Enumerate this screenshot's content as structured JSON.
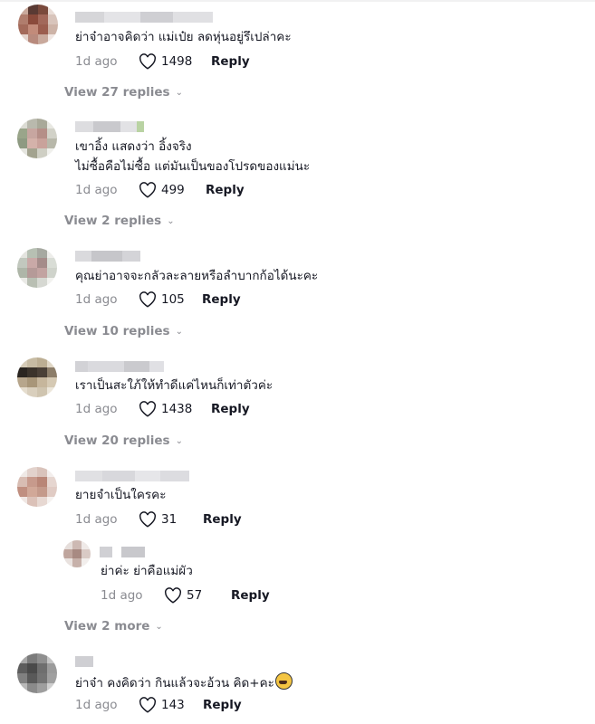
{
  "comments": [
    {
      "text_lines": [
        "ย่าจ๋าอาจคิดว่า แม่เป๋ย ลดหุ่นอยู่รึเปล่าคะ"
      ],
      "time": "1d ago",
      "likes": "1498",
      "reply_label": "Reply",
      "view_replies": "View 27 replies"
    },
    {
      "text_lines": [
        "เขาอิ้ง แสดงว่า อิ้งจริง",
        "ไม่ซื้อคือไม่ซื้อ แต่มันเป็นของโปรดของแม่นะ"
      ],
      "time": "1d ago",
      "likes": "499",
      "reply_label": "Reply",
      "view_replies": "View 2 replies"
    },
    {
      "text_lines": [
        "คุณย่าอาจจะกลัวละลายหรือลำบากก้อได้นะคะ"
      ],
      "time": "1d ago",
      "likes": "105",
      "reply_label": "Reply",
      "view_replies": "View 10 replies"
    },
    {
      "text_lines": [
        "เราเป็นสะใภ้ให้ทำดีแค่ไหนก็เท่าตัวค่ะ"
      ],
      "time": "1d ago",
      "likes": "1438",
      "reply_label": "Reply",
      "view_replies": "View 20 replies"
    },
    {
      "text_lines": [
        "ยายจำเป็นใครคะ"
      ],
      "time": "1d ago",
      "likes": "31",
      "reply_label": "Reply"
    }
  ],
  "nested_reply": {
    "text": "ย่าค่ะ ย่าคือแม่ผัว",
    "time": "1d ago",
    "likes": "57",
    "reply_label": "Reply",
    "view_more": "View 2 more"
  },
  "last_comment": {
    "text": "ย่าจ๋า คงคิดว่า กินแล้วจะอ้วน คิด+คะ",
    "emoji_icon": "weary-face-emoji",
    "time": "1d ago",
    "likes": "143",
    "reply_label": "Reply"
  },
  "colors": {
    "text": "#161823",
    "muted": "#8a8b91",
    "background": "#ffffff"
  }
}
